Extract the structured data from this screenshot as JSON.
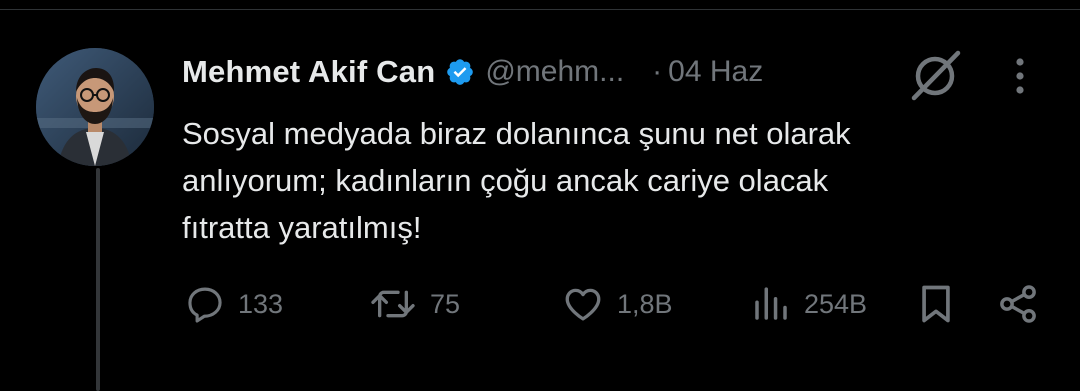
{
  "tweet": {
    "author_name": "Mehmet Akif Can",
    "handle": "@mehm...",
    "separator": "·",
    "date": "04 Haz",
    "text": "Sosyal medyada biraz dolanınca şunu net olarak\nanlıyorum; kadınların çoğu ancak cariye olacak\nfıtratta yaratılmış!",
    "verified_color": "#1d9bf0"
  },
  "actions": {
    "replies": "133",
    "reposts": "75",
    "likes": "1,8B",
    "views": "254B"
  },
  "icons": {
    "avatar": "profile-photo",
    "verified": "verified-badge-icon",
    "grok": "grok-icon",
    "more": "more-options-icon",
    "reply": "reply-icon",
    "repost": "repost-icon",
    "like": "heart-icon",
    "views": "views-chart-icon",
    "bookmark": "bookmark-icon",
    "share": "share-icon"
  },
  "colors": {
    "background": "#000000",
    "text_primary": "#e7e9ea",
    "text_secondary": "#71767b",
    "thread_line": "#333639"
  }
}
